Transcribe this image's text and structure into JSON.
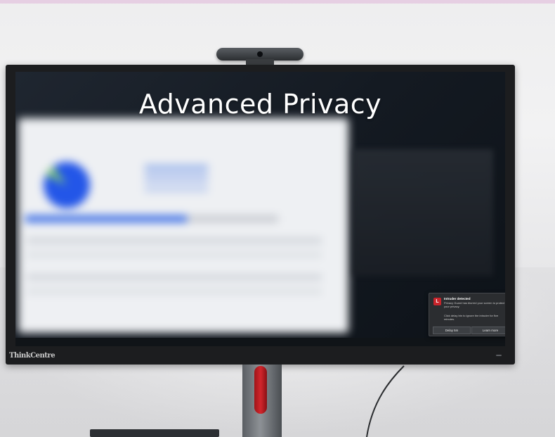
{
  "headline": "Advanced Privacy",
  "brand": "ThinkCentre",
  "toast": {
    "icon_letter": "L",
    "title": "Intruder detected",
    "body": "Privacy Guard has blurred your screen to protect your privacy.",
    "hint": "Click delay btn to ignore the intruder for five minutes.",
    "buttons": {
      "delay": "Delay 5m",
      "learn": "Learn more"
    },
    "close": "×"
  },
  "background_window": {
    "progress": 0.64
  },
  "colors": {
    "accent_red": "#c8242b",
    "chart_blue": "#2356e8",
    "bezel": "#1c1d1f"
  },
  "icons": [
    "webcam-icon",
    "lenovo-logo-icon",
    "close-icon"
  ]
}
